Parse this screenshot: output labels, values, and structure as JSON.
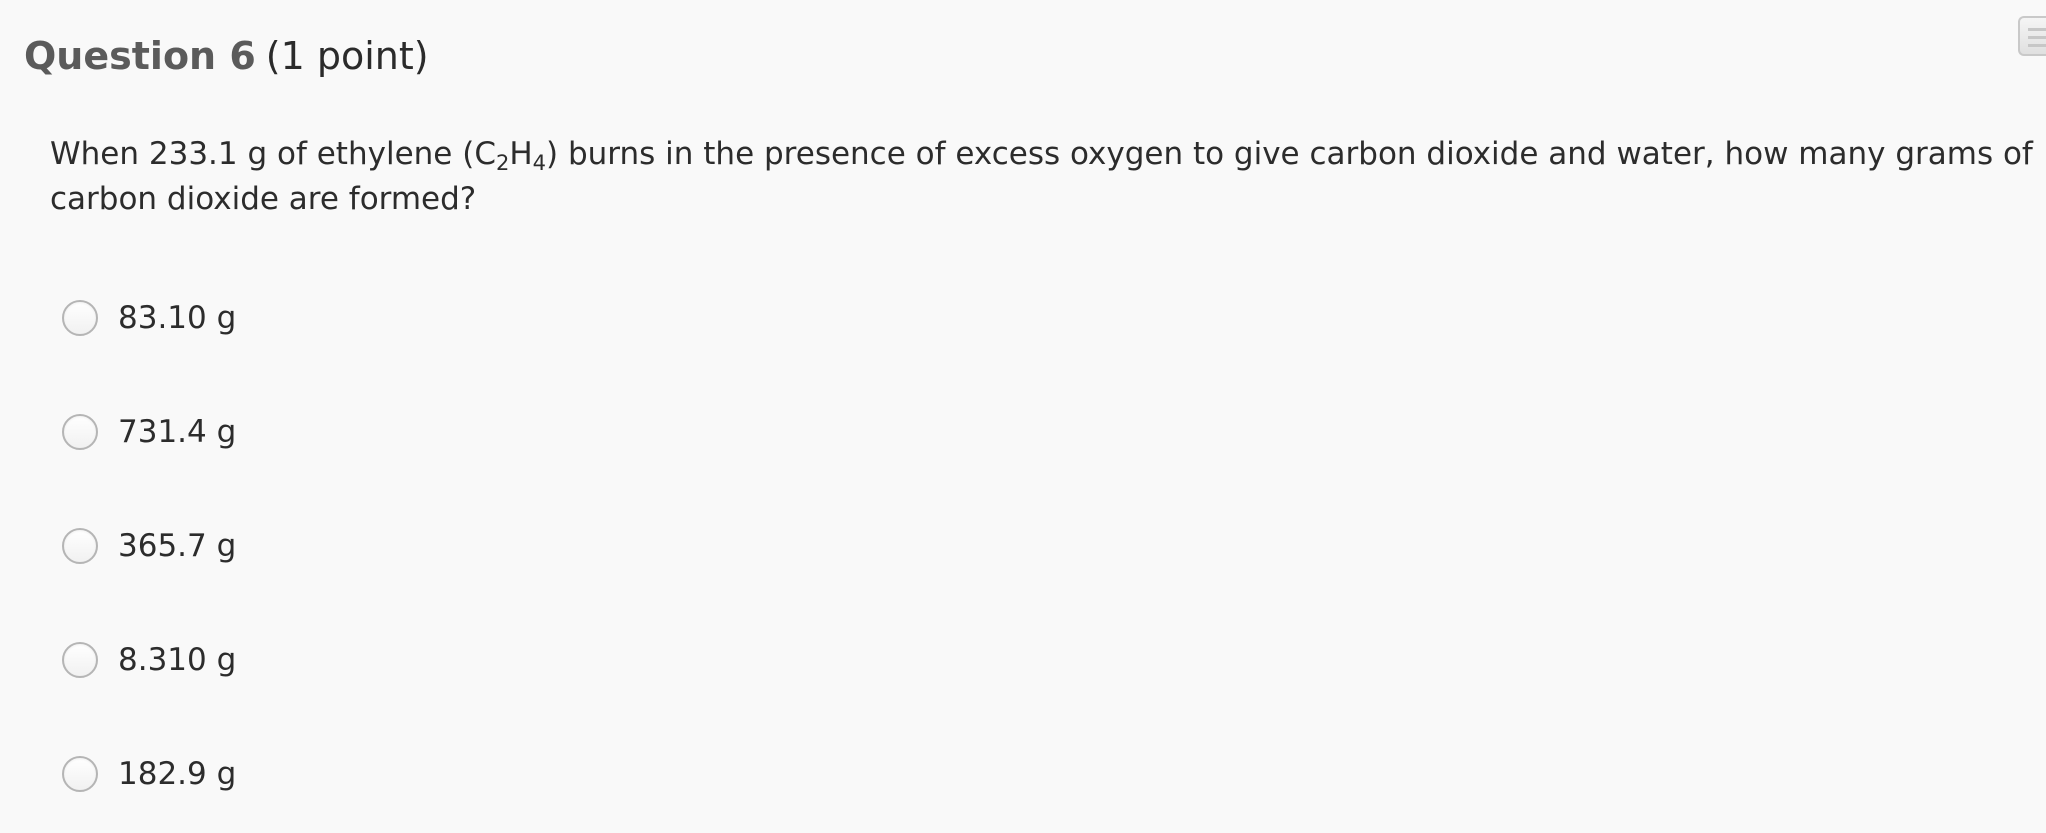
{
  "question": {
    "label": "Question 6",
    "points": "(1 point)",
    "text_before_formula": "When 233.1 g of ethylene (C",
    "formula_sub_1": "2",
    "formula_mid": "H",
    "formula_sub_2": "4",
    "text_after_formula": ") burns in the presence of excess oxygen to give carbon dioxide and water, how many grams of carbon dioxide are formed?"
  },
  "options": [
    {
      "label": "83.10 g",
      "selected": false
    },
    {
      "label": "731.4 g",
      "selected": false
    },
    {
      "label": "365.7 g",
      "selected": false
    },
    {
      "label": "8.310 g",
      "selected": false
    },
    {
      "label": "182.9 g",
      "selected": false
    }
  ],
  "icons": {
    "corner": "notes-icon"
  }
}
